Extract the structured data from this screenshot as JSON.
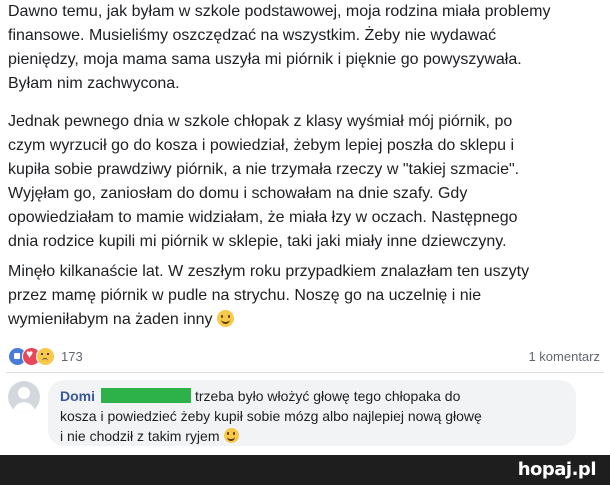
{
  "post": {
    "paragraph1": [
      "Dawno temu, jak byłam w szkole podstawowej, moja rodzina miała problemy",
      "finansowe. Musieliśmy oszczędzać na wszystkim. Żeby nie wydawać",
      "pieniędzy, moja mama sama uszyła mi piórnik i pięknie go powyszywała.",
      "Byłam nim zachwycona."
    ],
    "paragraph2": [
      "Jednak pewnego dnia w szkole chłopak z klasy wyśmiał mój piórnik, po",
      "czym wyrzucił go do kosza i powiedział, żebym lepiej poszła do sklepu i",
      "kupiła sobie prawdziwy piórnik, a nie trzymała rzeczy w \"takiej szmacie\".",
      "Wyjęłam go, zaniosłam do domu i schowałam na dnie szafy. Gdy",
      "opowiedziałam to mamie widziałam, że miała łzy w oczach. Następnego",
      "dnia rodzice kupili mi piórnik w sklepie, taki jaki miały inne dziewczyny."
    ],
    "paragraph3": [
      "Minęło kilkanaście lat. W zeszłym roku przypadkiem znalazłam ten uszyty",
      "przez mamę piórnik w pudle na strychu. Noszę go na uczelnię i nie",
      "wymieniłabym na żaden inny"
    ]
  },
  "reactions": {
    "icons": [
      "like-icon",
      "love-icon",
      "sad-icon"
    ],
    "count": "173",
    "comments_label": "1 komentarz"
  },
  "comment": {
    "author": "Domi",
    "lines": [
      "trzeba było włożyć głowę tego chłopaka do",
      "kosza i powiedzieć żeby kupił sobie mózg albo najlepiej nową głowę",
      "i nie chodził z takim ryjem"
    ],
    "name_mask_color": "#2db24a"
  },
  "footer": {
    "logo": "hopaj",
    "tld": ".pl"
  }
}
